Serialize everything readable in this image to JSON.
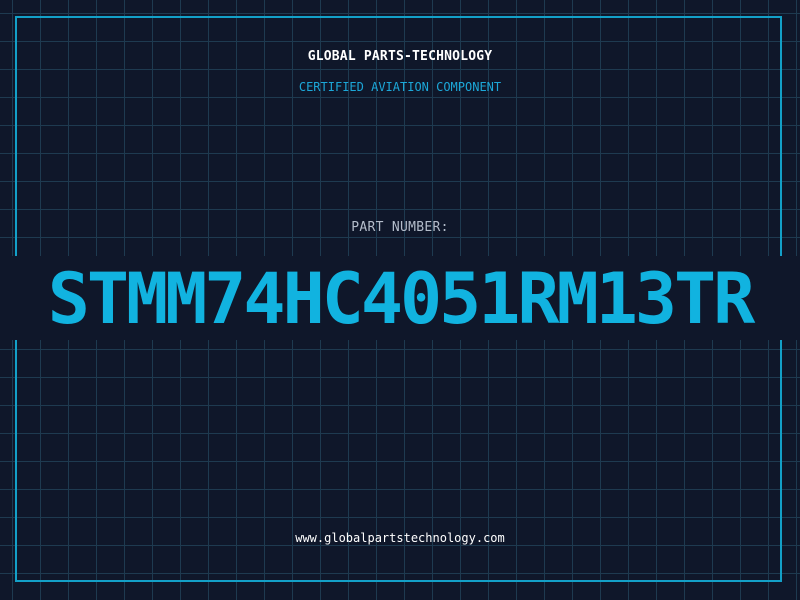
{
  "header": {
    "company": "GLOBAL PARTS-TECHNOLOGY",
    "subtitle": "CERTIFIED AVIATION COMPONENT"
  },
  "part": {
    "label": "PART NUMBER:",
    "number": "STMM74HC4051RM13TR"
  },
  "footer": {
    "url": "www.globalpartstechnology.com"
  },
  "colors": {
    "background": "#0f172a",
    "grid": "#1e3a50",
    "accent": "#11b3e0",
    "frame": "#13a0c8"
  }
}
